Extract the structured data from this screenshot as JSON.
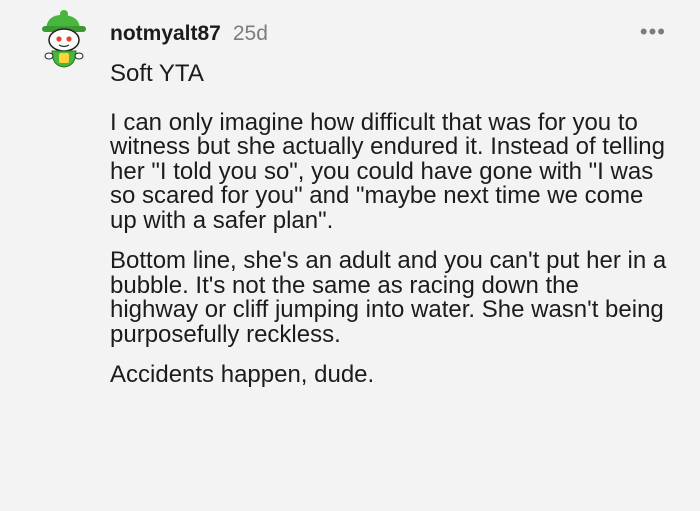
{
  "comment": {
    "username": "notmyalt87",
    "age": "25d",
    "more_label": "•••",
    "paragraphs": [
      "Soft YTA",
      "I can only imagine how difficult that was for you to witness but she actually endured it. Instead of telling her \"I told you so\", you could have gone with \"I was so scared for you\" and \"maybe next time we come up with a safer plan\".",
      "Bottom line, she's an adult and you can't put her in a bubble. It's not the same as racing down the highway or cliff jumping into water. She wasn't being purposefully reckless.",
      "Accidents happen, dude."
    ],
    "avatar_icon": "snoo-avatar-green-hat-icon",
    "more_icon": "more-options-icon"
  },
  "colors": {
    "background": "#f3f3f3",
    "text": "#1c1c1c",
    "muted": "#7c7c7c",
    "avatar_green": "#46b63c"
  }
}
